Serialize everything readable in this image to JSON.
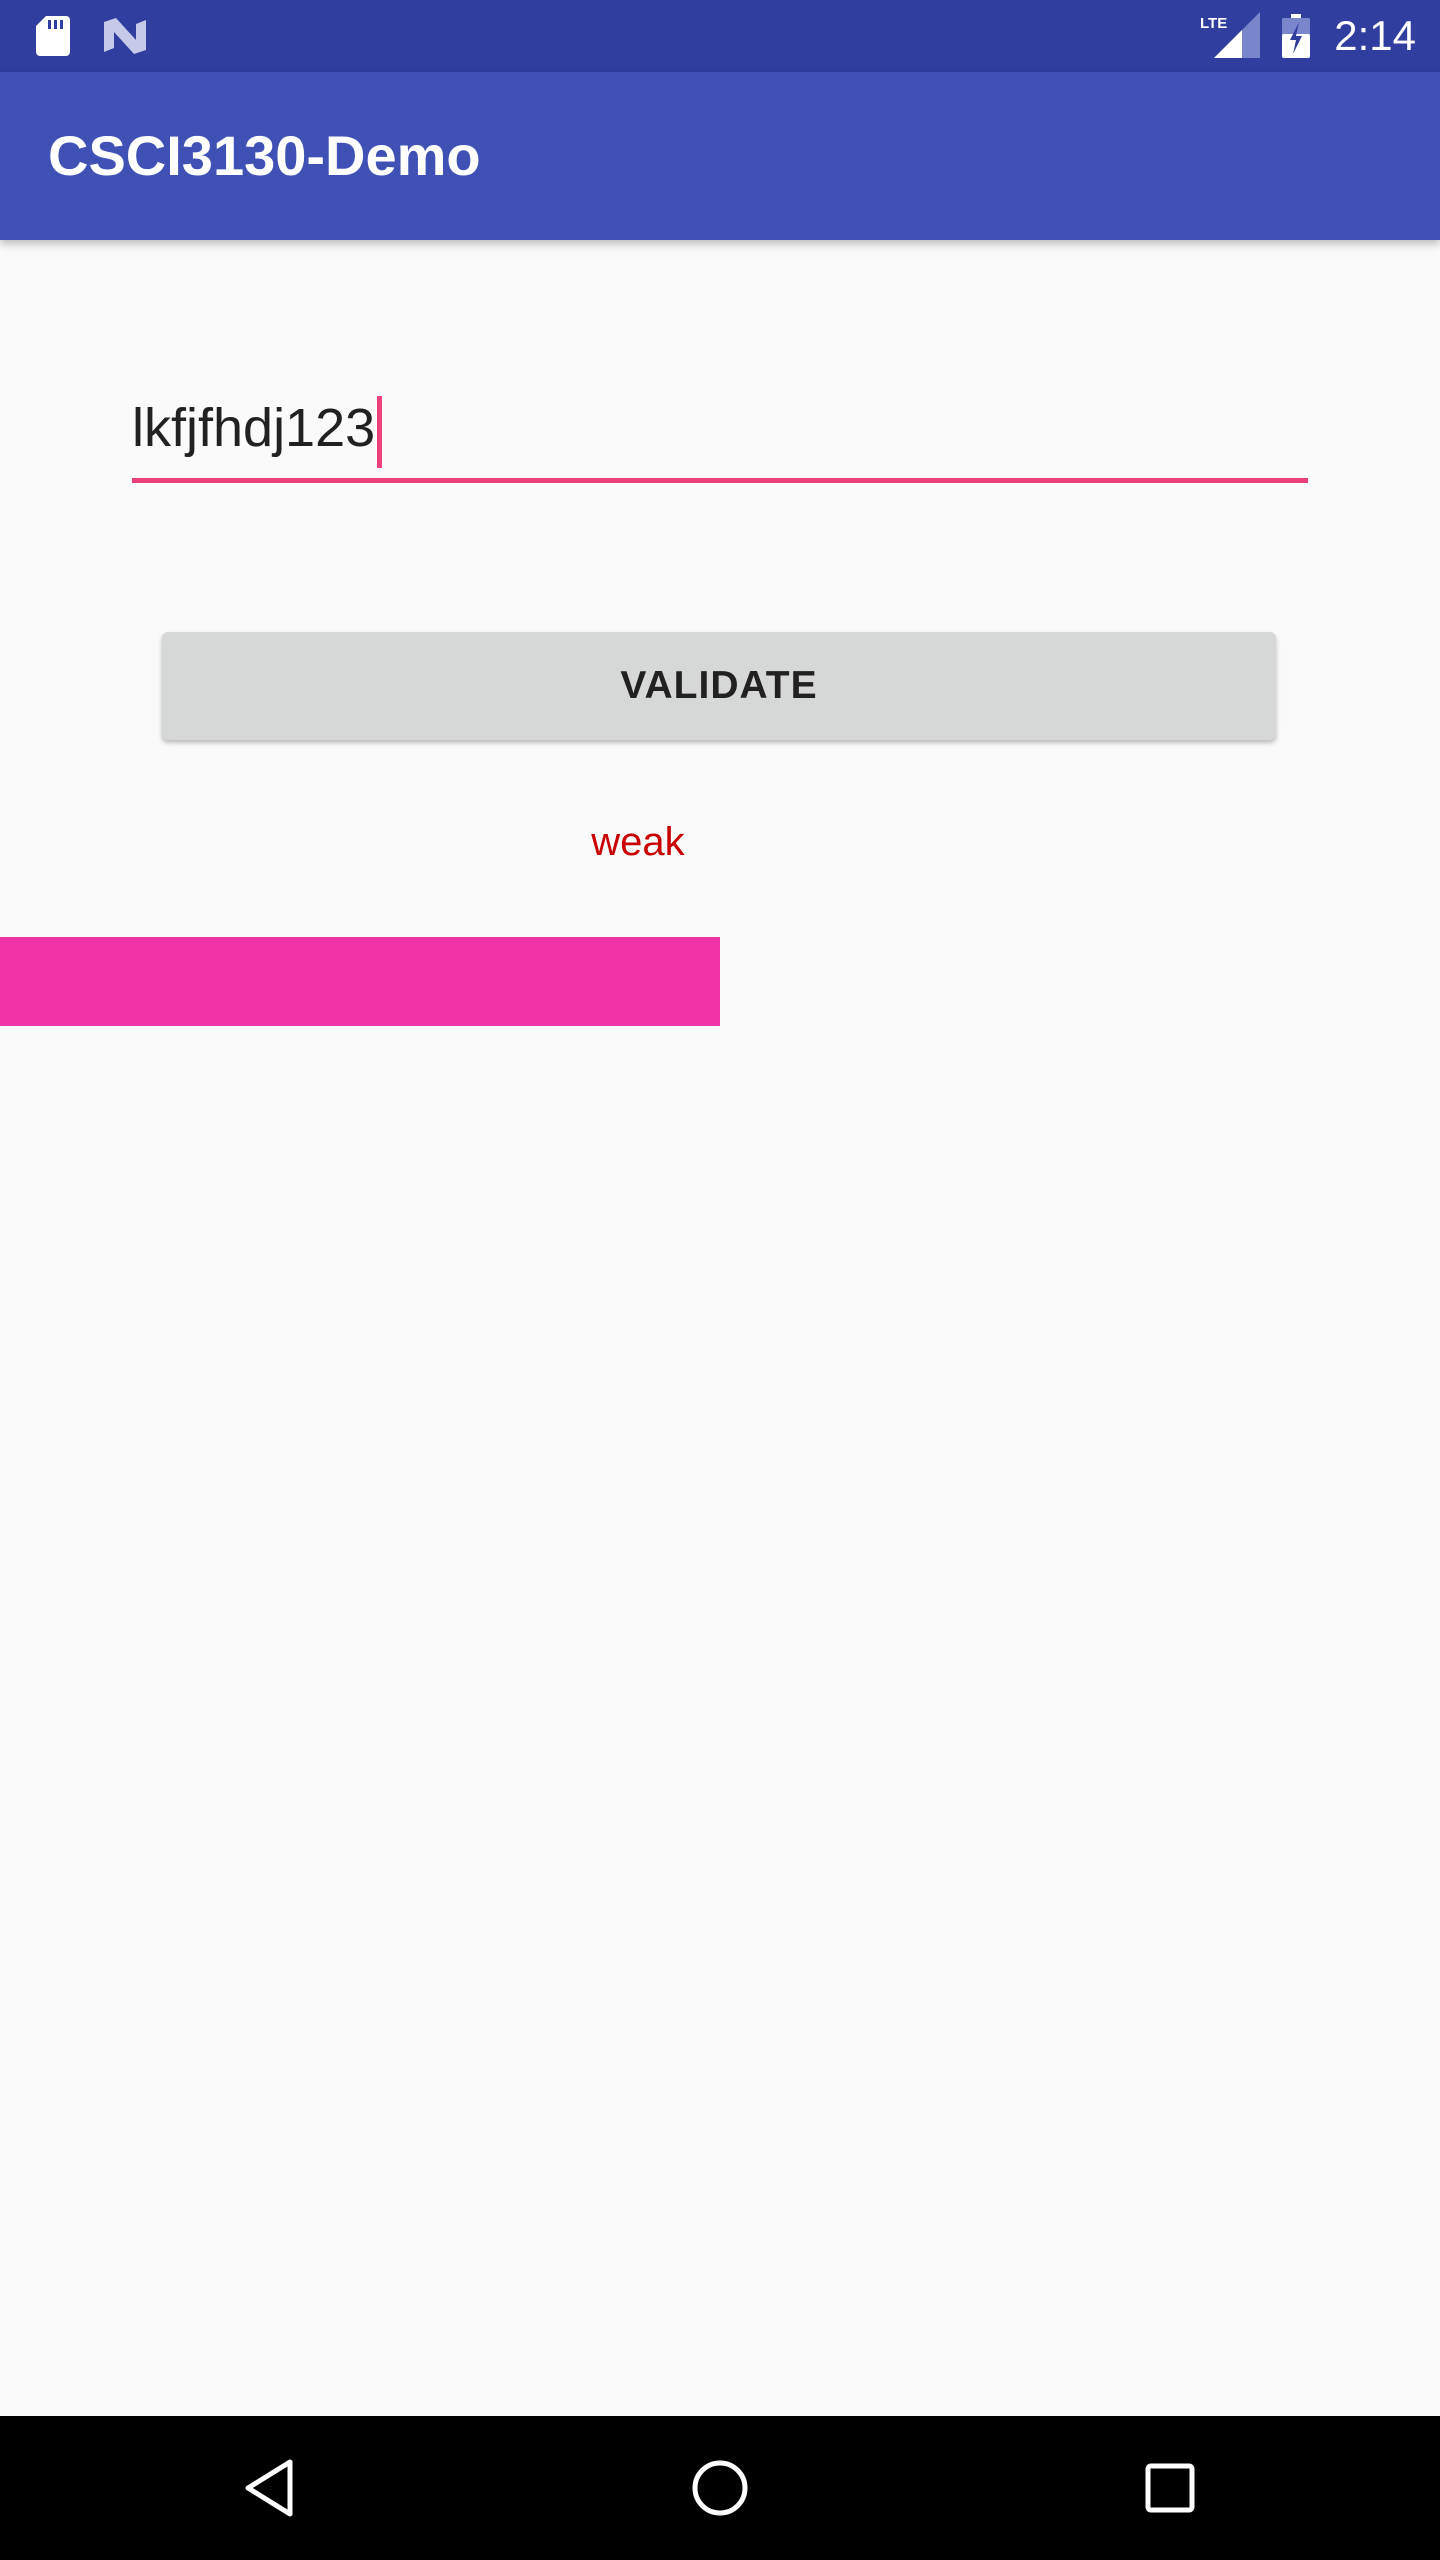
{
  "status_bar": {
    "time": "2:14",
    "network": "LTE",
    "icons": [
      "sd-card-icon",
      "n-notification-icon",
      "lte-signal-icon",
      "battery-charging-icon"
    ],
    "background": "#303f9f"
  },
  "app_bar": {
    "title": "CSCI3130-Demo",
    "background": "#3f51b5"
  },
  "password_input": {
    "value": "lkfjfhdj123",
    "accent": "#ec407a"
  },
  "validate_button": {
    "label": "VALIDATE"
  },
  "strength": {
    "label": "weak",
    "label_color": "#c80000",
    "bar_color": "#f034a8",
    "level_fraction": 0.5
  },
  "nav_bar": {
    "icons": [
      "back-icon",
      "home-icon",
      "recents-icon"
    ]
  }
}
